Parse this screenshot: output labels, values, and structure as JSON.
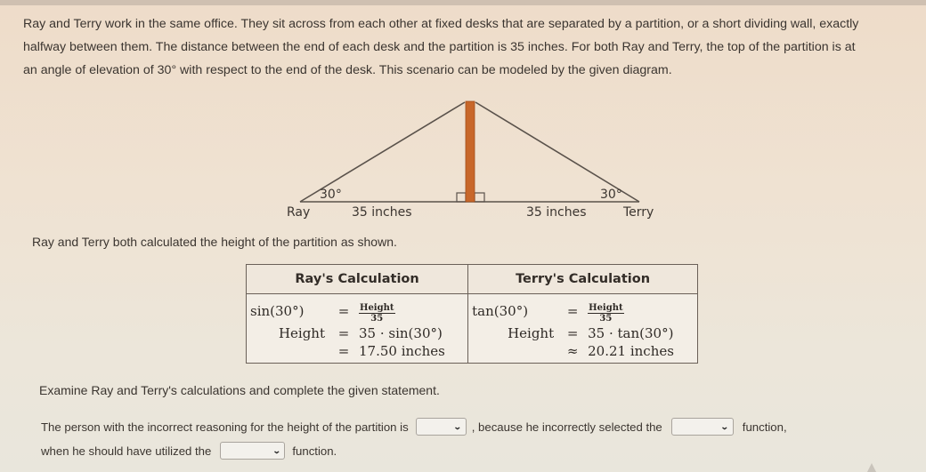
{
  "problem": {
    "lines": [
      "Ray and Terry work in the same office. They sit across from each other at fixed desks that are separated by a partition, or a short dividing wall, exactly",
      "halfway between them. The distance between the end of each desk and the partition is 35 inches. For both Ray and Terry, the top of the partition is at",
      "an angle of elevation of 30° with respect to the end of the desk. This scenario can be modeled by the given diagram."
    ]
  },
  "diagram": {
    "left_label": "Ray",
    "right_label": "Terry",
    "left_distance": "35 inches",
    "right_distance": "35 inches",
    "left_angle": "30°",
    "right_angle": "30°",
    "partition_color": "#c8672a",
    "line_color": "#5a524b"
  },
  "intro2": "Ray and Terry both calculated the height of the partition as shown.",
  "table": {
    "headers": [
      "Ray's Calculation",
      "Terry's Calculation"
    ],
    "ray": {
      "rows": [
        {
          "lhs": "sin(30°)",
          "op": "=",
          "frac_num": "Height",
          "frac_den": "35"
        },
        {
          "lhs": "Height",
          "op": "=",
          "rhs": "35 · sin(30°)"
        },
        {
          "lhs": "",
          "op": "=",
          "rhs": "17.50 inches"
        }
      ]
    },
    "terry": {
      "rows": [
        {
          "lhs": "tan(30°)",
          "op": "=",
          "frac_num": "Height",
          "frac_den": "35"
        },
        {
          "lhs": "Height",
          "op": "=",
          "rhs": "35 · tan(30°)"
        },
        {
          "lhs": "",
          "op": "≈",
          "rhs": "20.21 inches"
        }
      ]
    }
  },
  "examine": "Examine Ray and Terry's calculations and complete the given statement.",
  "statement": {
    "part1": "The person with the incorrect reasoning for the height of the partition is",
    "part2": ", because he incorrectly selected the",
    "part3": "function,",
    "part4": "when he should have utilized the",
    "part5": "function.",
    "select_person_value": "",
    "select_wrong_function_value": "",
    "select_right_function_value": "",
    "chevron_icon": "⌄"
  }
}
